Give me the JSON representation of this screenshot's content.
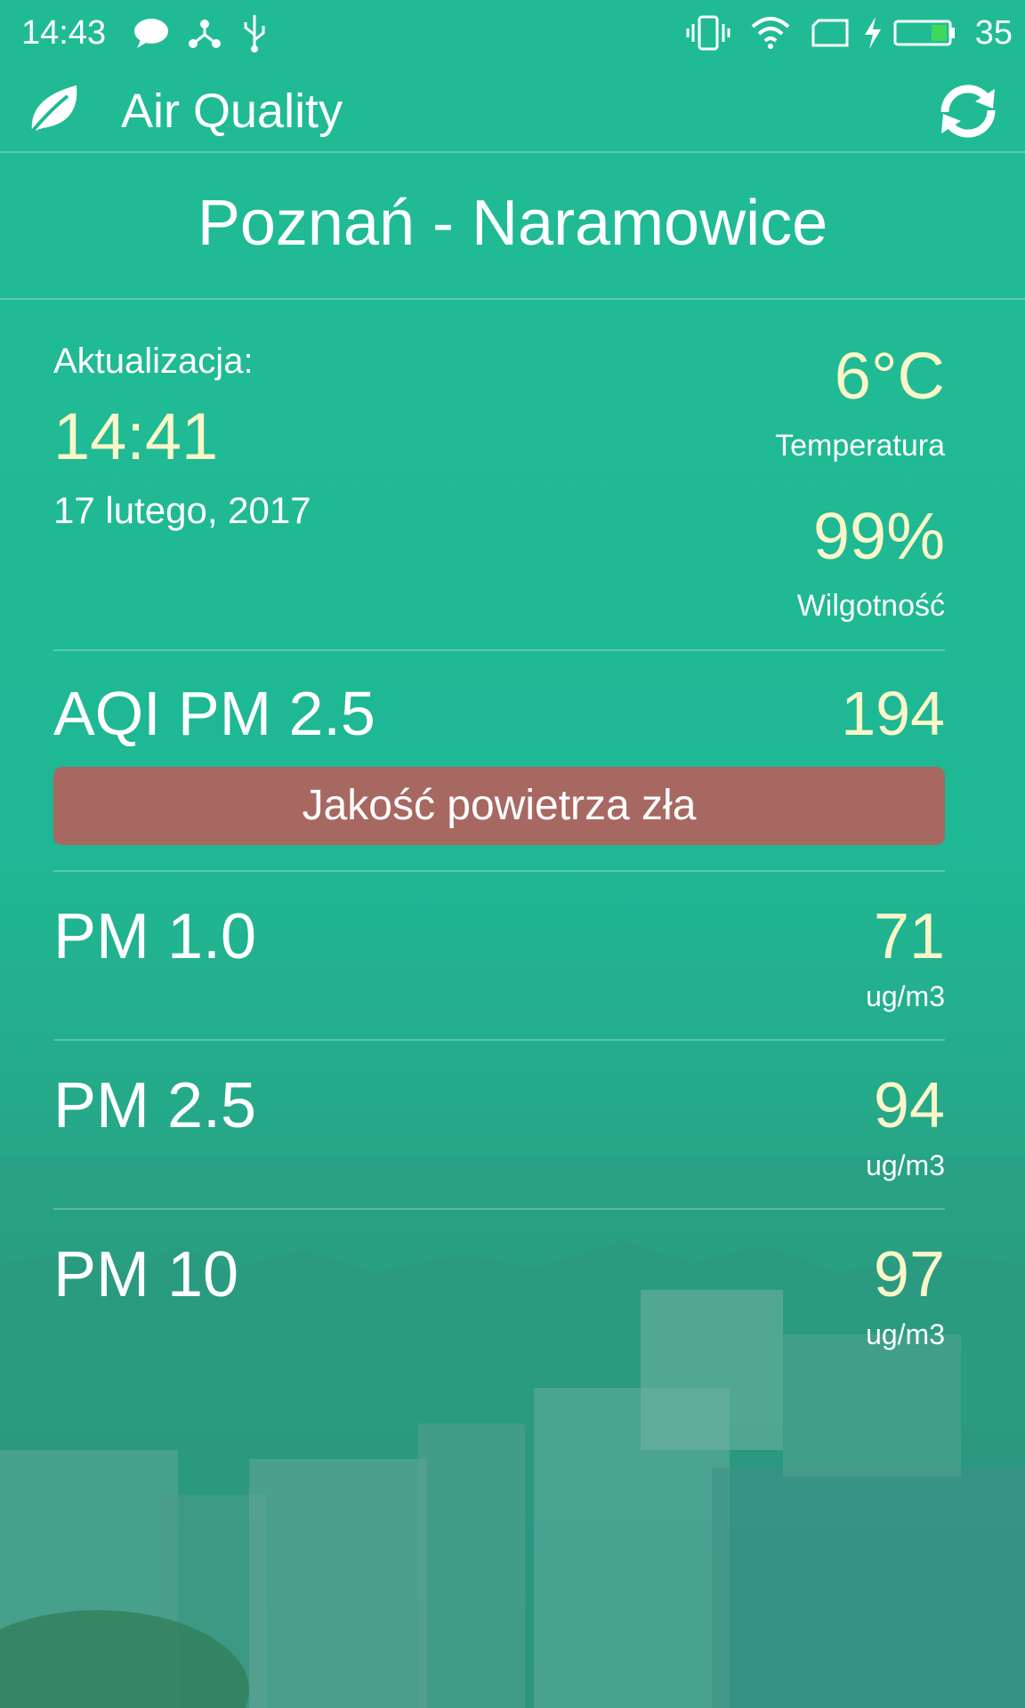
{
  "status_bar": {
    "time": "14:43",
    "battery_level": "35"
  },
  "app_bar": {
    "title": "Air Quality"
  },
  "station": {
    "name": "Poznań - Naramowice"
  },
  "update": {
    "label": "Aktualizacja:",
    "time": "14:41",
    "date": "17 lutego, 2017"
  },
  "weather": {
    "temperature": "6°C",
    "temperature_label": "Temperatura",
    "humidity": "99%",
    "humidity_label": "Wilgotność"
  },
  "aqi": {
    "label": "AQI PM 2.5",
    "value": "194",
    "quality_text": "Jakość powietrza zła",
    "quality_color": "#a86862"
  },
  "measurements": [
    {
      "label": "PM 1.0",
      "value": "71",
      "unit": "ug/m3"
    },
    {
      "label": "PM 2.5",
      "value": "94",
      "unit": "ug/m3"
    },
    {
      "label": "PM 10",
      "value": "97",
      "unit": "ug/m3"
    }
  ],
  "colors": {
    "background": "#1db995",
    "value_accent": "#fbf6c9"
  }
}
